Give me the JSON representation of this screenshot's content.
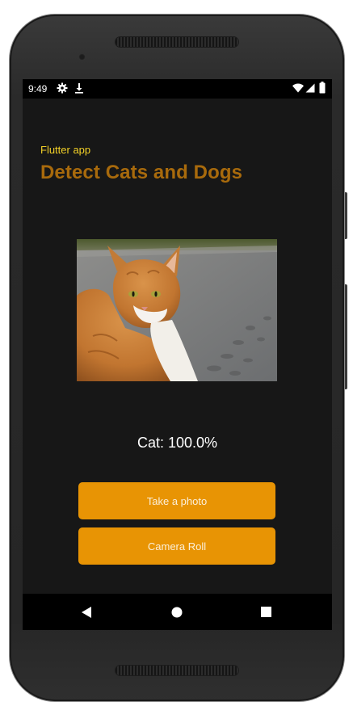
{
  "status_bar": {
    "time": "9:49",
    "left_icons": [
      "settings-icon",
      "download-icon"
    ],
    "right_icons": [
      "wifi-icon",
      "signal-icon",
      "battery-icon"
    ]
  },
  "app": {
    "subtitle": "Flutter app",
    "title": "Detect Cats and Dogs"
  },
  "photo": {
    "subject": "cat-photo"
  },
  "prediction": {
    "label": "Cat: 100.0%"
  },
  "buttons": {
    "take_photo": "Take a photo",
    "camera_roll": "Camera Roll"
  },
  "nav": {
    "items": [
      "back-icon",
      "home-icon",
      "recents-icon"
    ]
  },
  "colors": {
    "background": "#171717",
    "subtitle": "#f2d027",
    "title": "#a86a0c",
    "button": "#e89404",
    "button_text": "#fbefd9"
  }
}
